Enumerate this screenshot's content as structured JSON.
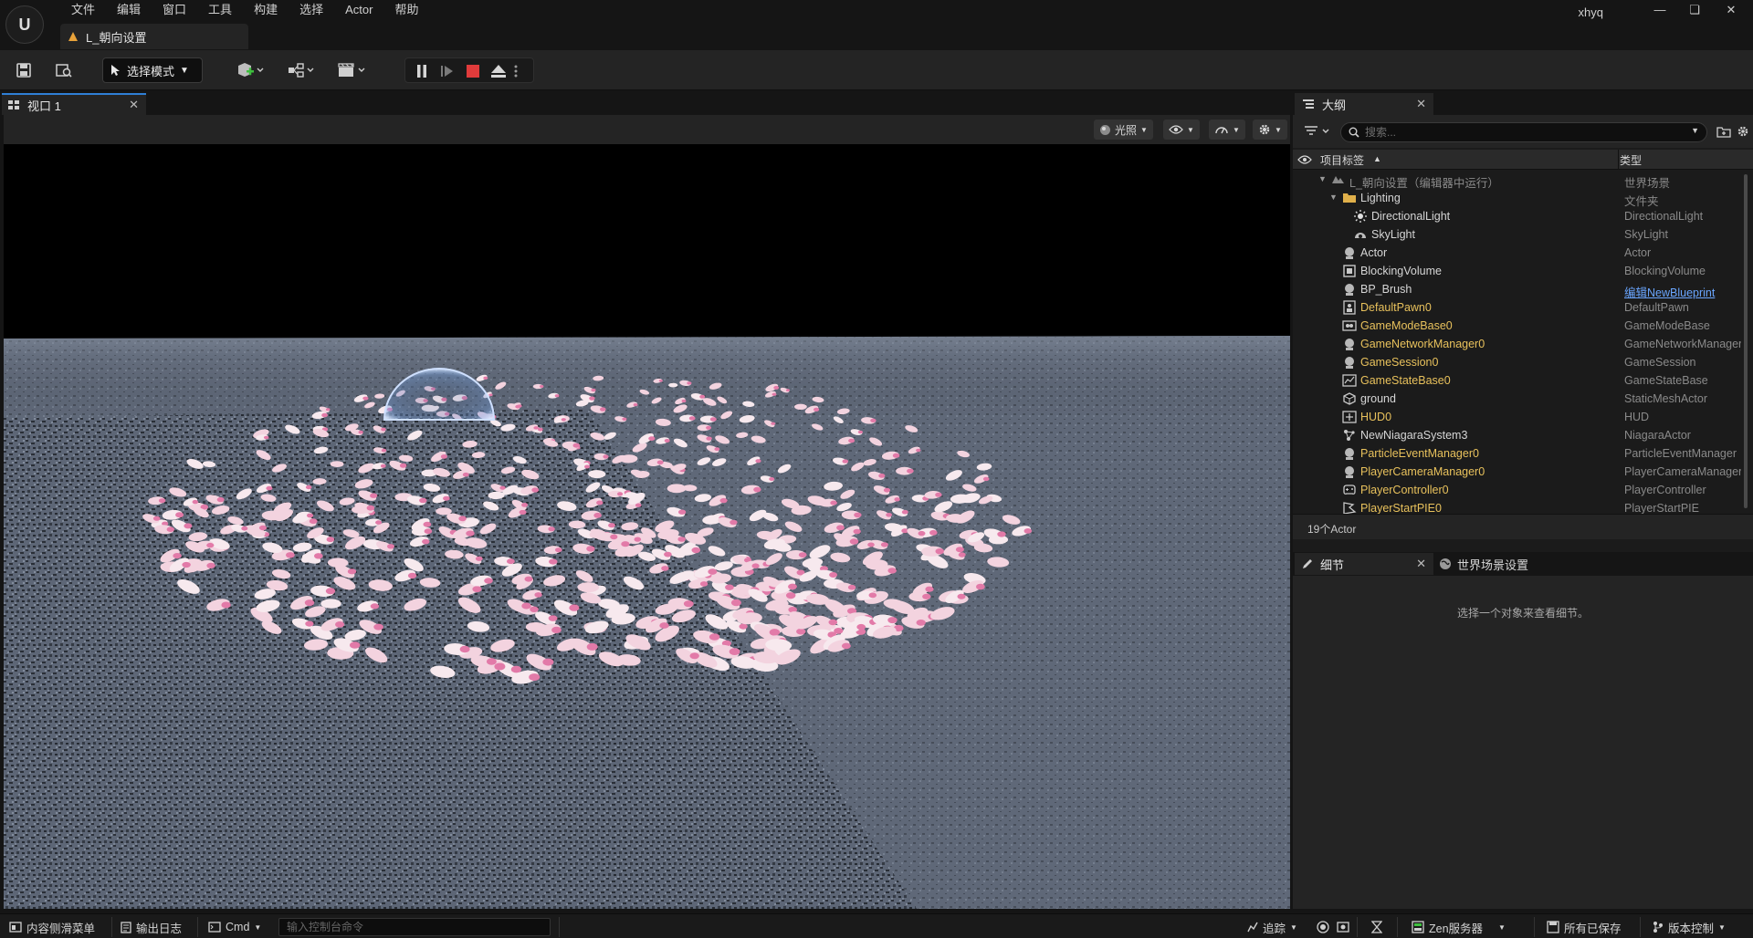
{
  "menu": [
    "文件",
    "编辑",
    "窗口",
    "工具",
    "构建",
    "选择",
    "Actor",
    "帮助"
  ],
  "document_tab": "L_朝向设置",
  "user": "xhyq",
  "toolbar": {
    "mode_label": "选择模式"
  },
  "viewport": {
    "tab_label": "视口 1",
    "lighting_label": "光照"
  },
  "outliner": {
    "tab_label": "大纲",
    "search_placeholder": "搜索...",
    "col_label": "项目标签",
    "col_type": "类型",
    "rows": [
      {
        "name": "L_朝向设置（编辑器中运行）",
        "type": "世界场景",
        "depth": 0,
        "icon": "level-icon",
        "color": "grey",
        "expanded": true
      },
      {
        "name": "Lighting",
        "type": "文件夹",
        "depth": 1,
        "icon": "folder-icon",
        "color": "white",
        "expanded": true
      },
      {
        "name": "DirectionalLight",
        "type": "DirectionalLight",
        "depth": 2,
        "icon": "directional-light-icon",
        "color": "white"
      },
      {
        "name": "SkyLight",
        "type": "SkyLight",
        "depth": 2,
        "icon": "sky-light-icon",
        "color": "white"
      },
      {
        "name": "Actor",
        "type": "Actor",
        "depth": 1,
        "icon": "actor-icon",
        "color": "white"
      },
      {
        "name": "BlockingVolume",
        "type": "BlockingVolume",
        "depth": 1,
        "icon": "volume-icon",
        "color": "white"
      },
      {
        "name": "BP_Brush",
        "type": "编辑NewBlueprint",
        "depth": 1,
        "icon": "actor-icon",
        "color": "white",
        "type_link": true
      },
      {
        "name": "DefaultPawn0",
        "type": "DefaultPawn",
        "depth": 1,
        "icon": "pawn-icon",
        "color": "yellow"
      },
      {
        "name": "GameModeBase0",
        "type": "GameModeBase",
        "depth": 1,
        "icon": "gamemode-icon",
        "color": "yellow"
      },
      {
        "name": "GameNetworkManager0",
        "type": "GameNetworkManager",
        "depth": 1,
        "icon": "actor-icon",
        "color": "yellow"
      },
      {
        "name": "GameSession0",
        "type": "GameSession",
        "depth": 1,
        "icon": "actor-icon",
        "color": "yellow"
      },
      {
        "name": "GameStateBase0",
        "type": "GameStateBase",
        "depth": 1,
        "icon": "gamestate-icon",
        "color": "yellow"
      },
      {
        "name": "ground",
        "type": "StaticMeshActor",
        "depth": 1,
        "icon": "static-mesh-icon",
        "color": "white"
      },
      {
        "name": "HUD0",
        "type": "HUD",
        "depth": 1,
        "icon": "hud-icon",
        "color": "yellow"
      },
      {
        "name": "NewNiagaraSystem3",
        "type": "NiagaraActor",
        "depth": 1,
        "icon": "niagara-icon",
        "color": "white"
      },
      {
        "name": "ParticleEventManager0",
        "type": "ParticleEventManager",
        "depth": 1,
        "icon": "actor-icon",
        "color": "yellow"
      },
      {
        "name": "PlayerCameraManager0",
        "type": "PlayerCameraManager",
        "depth": 1,
        "icon": "actor-icon",
        "color": "yellow"
      },
      {
        "name": "PlayerController0",
        "type": "PlayerController",
        "depth": 1,
        "icon": "controller-icon",
        "color": "yellow"
      },
      {
        "name": "PlayerStartPIE0",
        "type": "PlayerStartPIE",
        "depth": 1,
        "icon": "player-start-icon",
        "color": "yellow"
      }
    ],
    "footer": "19个Actor"
  },
  "details": {
    "tab_label": "细节",
    "world_settings_label": "世界场景设置",
    "empty_text": "选择一个对象来查看细节。"
  },
  "statusbar": {
    "content_drawer": "内容侧滑菜单",
    "output_log": "输出日志",
    "cmd": "Cmd",
    "console_placeholder": "输入控制台命令",
    "trace": "追踪",
    "zen": "Zen服务器",
    "saved": "所有已保存",
    "source_control": "版本控制"
  },
  "colors": {
    "accent": "#2f7fd6",
    "actor_yellow": "#e8c15c",
    "stop_red": "#e03b3b",
    "petal": "#f2c6d6"
  }
}
